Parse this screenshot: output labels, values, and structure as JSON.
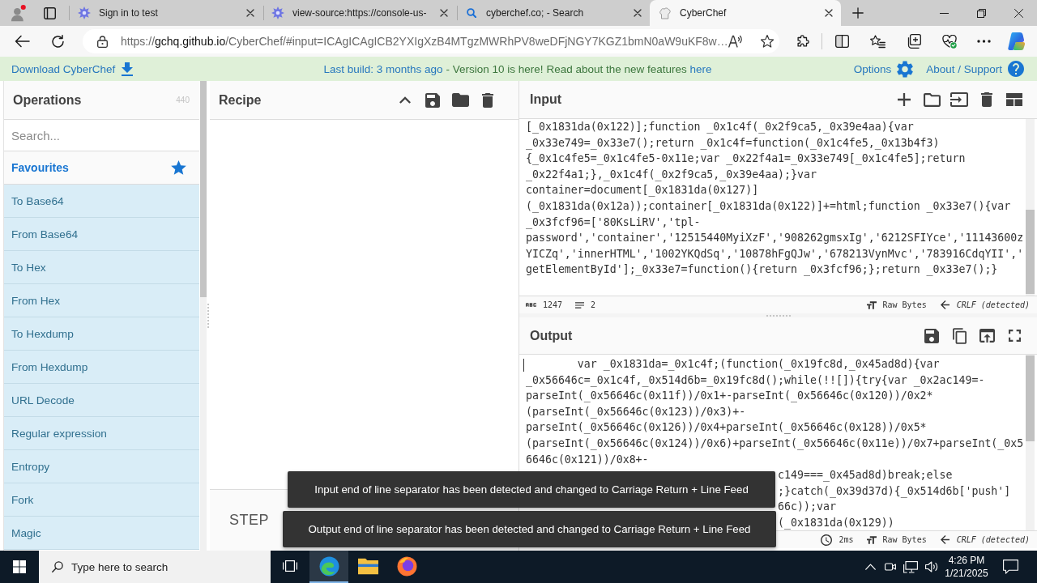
{
  "browser": {
    "tabs": [
      {
        "kind": "site",
        "title": "Sign in to test",
        "selected": false
      },
      {
        "kind": "site",
        "title": "view-source:https://console-us-",
        "selected": false
      },
      {
        "kind": "search",
        "title": "cyberchef.co; - Search",
        "selected": false
      },
      {
        "kind": "app",
        "title": "CyberChef",
        "selected": true
      }
    ],
    "url": {
      "scheme": "https://",
      "host": "gchq.github.io",
      "path": "/CyberChef/#input=ICAgICAgICB2YXIgXzB4MTgzMWRhPV8weDFjNGY7KGZ1bmN0aW9uKF8w…"
    }
  },
  "banner": {
    "download": "Download CyberChef",
    "build": "Last build: 3 months ago",
    "message": "- Version 10 is here! Read about the new features",
    "link": "here",
    "options": "Options",
    "about": "About / Support"
  },
  "operations": {
    "title": "Operations",
    "count": "440",
    "search": {
      "placeholder": "Search..."
    },
    "favourites": "Favourites",
    "items": [
      "To Base64",
      "From Base64",
      "To Hex",
      "From Hex",
      "To Hexdump",
      "From Hexdump",
      "URL Decode",
      "Regular expression",
      "Entropy",
      "Fork",
      "Magic"
    ]
  },
  "recipe": {
    "title": "Recipe",
    "step": "STEP"
  },
  "input": {
    "title": "Input",
    "lines": [
      "[_0x1831da(0x122)];function _0x1c4f(_0x2f9ca5,_0x39e4aa){var",
      "_0x33e749=_0x33e7();return _0x1c4f=function(_0x1c4fe5,_0x13b4f3)",
      "{_0x1c4fe5=_0x1c4fe5-0x11e;var _0x22f4a1=_0x33e749[_0x1c4fe5];return",
      "_0x22f4a1;},_0x1c4f(_0x2f9ca5,_0x39e4aa);}var",
      "container=document[_0x1831da(0x127)]",
      "(_0x1831da(0x12a));container[_0x1831da(0x122)]+=html;function _0x33e7(){var",
      "_0x3fcf96=['80KsLiRV','tpl-",
      "password','container','12515440MyiXzF','908262gmsxIg','6212SFIYce','11143600z",
      "YICZq','innerHTML','1002YKQdSq','10878hFgQJw','678213VynMvc','783916CdqYII','",
      "getElementById'];_0x33e7=function(){return _0x3fcf96;};return _0x33e7();}"
    ],
    "status": {
      "length": "1247",
      "lines": "2",
      "format": "Raw Bytes",
      "eol": "CRLF (detected)"
    }
  },
  "output": {
    "title": "Output",
    "lines": [
      {
        "kind": "full",
        "text": "        var _0x1831da=_0x1c4f;(function(_0x19fc8d,_0x45ad8d){var"
      },
      {
        "kind": "full",
        "text": "_0x56646c=_0x1c4f,_0x514d6b=_0x19fc8d();while(!![]){try{var _0x2ac149=-"
      },
      {
        "kind": "full",
        "text": "parseInt(_0x56646c(0x11f))/0x1+-parseInt(_0x56646c(0x120))/0x2*"
      },
      {
        "kind": "full",
        "text": "(parseInt(_0x56646c(0x123))/0x3)+-"
      },
      {
        "kind": "full",
        "text": "parseInt(_0x56646c(0x126))/0x4+parseInt(_0x56646c(0x128))/0x5*"
      },
      {
        "kind": "full",
        "text": "(parseInt(_0x56646c(0x124))/0x6)+parseInt(_0x56646c(0x11e))/0x7+parseInt(_0x5"
      },
      {
        "kind": "full",
        "text": "6646c(0x121))/0x8+-"
      },
      {
        "kind": "cut",
        "text": "c149===_0x45ad8d)break;else"
      },
      {
        "kind": "cut",
        "text": ";}catch(_0x39d37d){_0x514d6b['push']"
      },
      {
        "kind": "cut",
        "text": "66c));var"
      },
      {
        "kind": "cut",
        "text": "(_0x1831da(0x129))"
      }
    ],
    "status": {
      "time": "2ms",
      "format": "Raw Bytes",
      "eol": "CRLF (detected)"
    }
  },
  "notifications": [
    "Input end of line separator has been detected and changed to Carriage Return + Line Feed",
    "Output end of line separator has been detected and changed to Carriage Return + Line Feed"
  ],
  "taskbar": {
    "search": {
      "placeholder": "Type here to search"
    },
    "apps": [
      {
        "kind": "task-view",
        "selected": false
      },
      {
        "kind": "edge",
        "selected": true
      },
      {
        "kind": "explorer",
        "selected": false
      },
      {
        "kind": "firefox",
        "selected": false
      }
    ],
    "time": "4:26 PM",
    "date": "1/21/2025"
  }
}
